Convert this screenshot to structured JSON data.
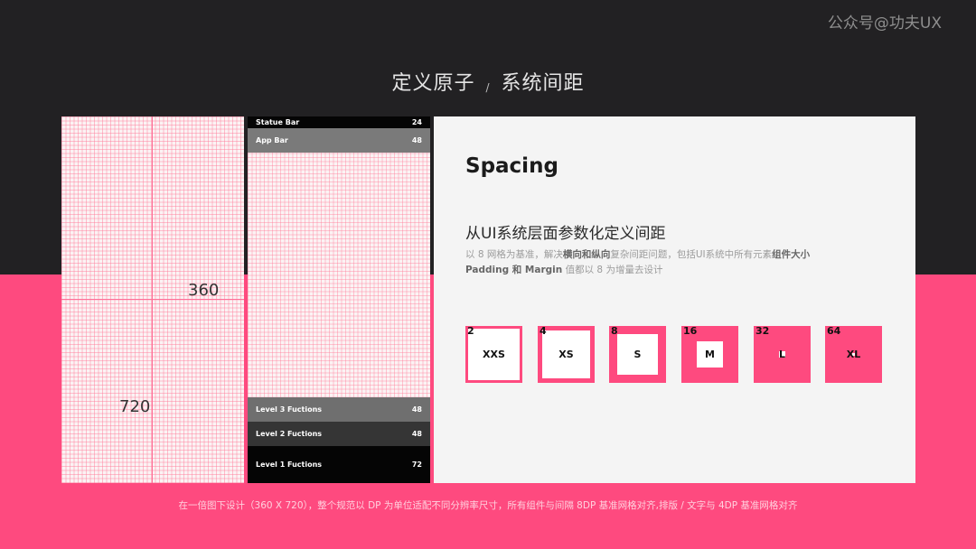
{
  "watermark": "公众号@功夫UX",
  "title": {
    "left": "定义原子",
    "separator": "/",
    "right": "系统间距"
  },
  "grid": {
    "width_label": "360",
    "height_label": "720"
  },
  "layout_bars": [
    {
      "label": "Statue Bar",
      "value": "24"
    },
    {
      "label": "App Bar",
      "value": "48"
    },
    {
      "label": "Level 3 Fuctions",
      "value": "48"
    },
    {
      "label": "Level 2 Fuctions",
      "value": "48"
    },
    {
      "label": "Level 1 Fuctions",
      "value": "72"
    }
  ],
  "card": {
    "heading": "Spacing",
    "subheading": "从UI系统层面参数化定义间距",
    "desc_line1": {
      "a": "以 8 网格为基准，解决",
      "b": "横向和纵向",
      "c": "复杂间距问题，包括UI系统中所有元素",
      "d": "组件大小"
    },
    "desc_line2": {
      "a": "Padding 和 Margin",
      "b": " 值都以 8 为增量去设计"
    }
  },
  "spacing_scale": [
    {
      "value": "2",
      "name": "XXS"
    },
    {
      "value": "4",
      "name": "XS"
    },
    {
      "value": "8",
      "name": "S"
    },
    {
      "value": "16",
      "name": "M"
    },
    {
      "value": "32",
      "name": "L"
    },
    {
      "value": "64",
      "name": "XL"
    }
  ],
  "colors": {
    "accent": "#fe4a7f",
    "dark": "#222123",
    "card": "#f4f4f4"
  },
  "footer": "在一倍图下设计（360 X 720），整个规范以 DP 为单位适配不同分辨率尺寸，所有组件与间隔 8DP 基准网格对齐,排版 / 文字与 4DP 基准网格对齐"
}
